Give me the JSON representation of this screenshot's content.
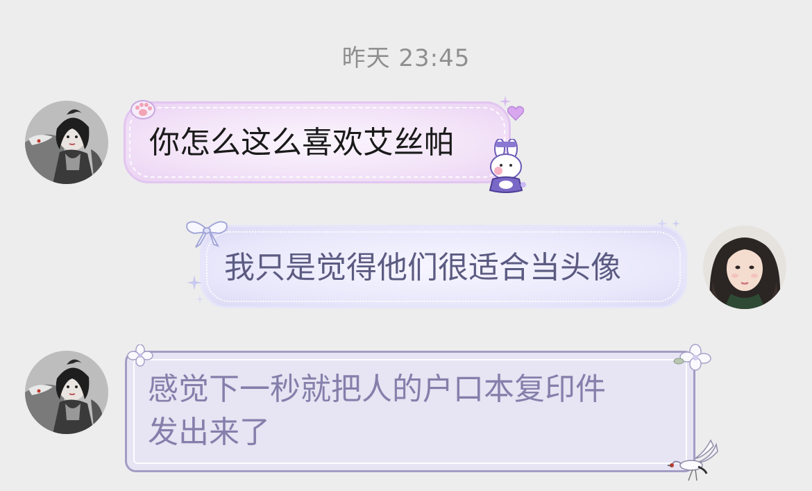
{
  "timestamp": "昨天 23:45",
  "messages": [
    {
      "side": "left",
      "avatar": "anime-girl-avatar",
      "text": "你怎么这么喜欢艾丝帕"
    },
    {
      "side": "right",
      "avatar": "girl-photo-avatar",
      "text": "我只是觉得他们很适合当头像"
    },
    {
      "side": "left",
      "avatar": "anime-girl-avatar",
      "lines": [
        "感觉下一秒就把人的户口本复印件",
        "发出来了"
      ]
    }
  ],
  "colors": {
    "background": "#ededed",
    "bubble_pink": "#f3e3f8",
    "bubble_lavender": "#e9e8fb",
    "bubble_grey_purple": "#e7e4f3",
    "bubble_grey_purple_border": "#a29cc4"
  },
  "icons": [
    "paw-icon",
    "heart-icon",
    "bunny-sticker-icon",
    "ribbon-bow-icon",
    "sparkle-icon",
    "flower-icon",
    "crane-icon"
  ]
}
